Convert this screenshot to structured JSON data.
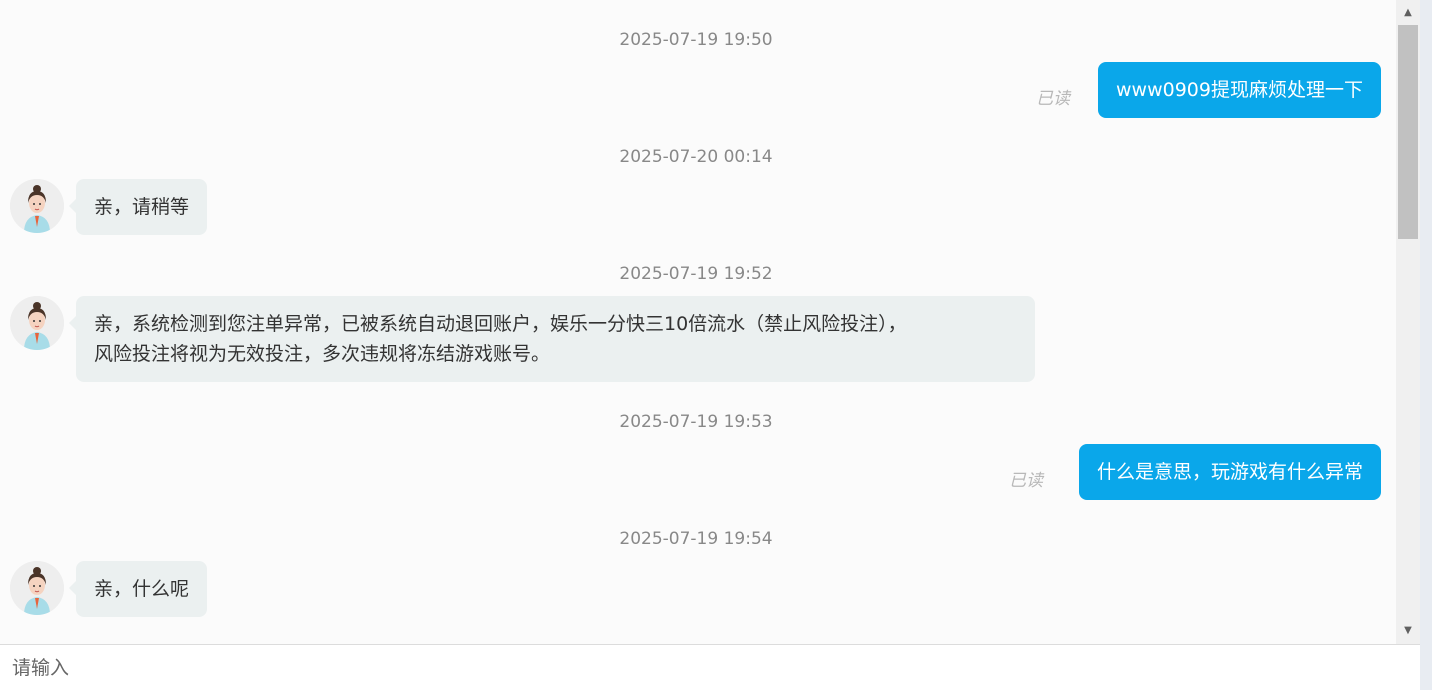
{
  "messages": [
    {
      "timestamp": "2025-07-19 19:50",
      "sender": "user",
      "text": "www0909提现麻烦处理一下",
      "status": "已读"
    },
    {
      "timestamp": "2025-07-20 00:14",
      "sender": "agent",
      "text": "亲，请稍等"
    },
    {
      "timestamp": "2025-07-19 19:52",
      "sender": "agent",
      "text_line1": "亲，系统检测到您注单异常，已被系统自动退回账户，娱乐一分快三10倍流水（禁止风险投注），",
      "text_line2": "风险投注将视为无效投注，多次违规将冻结游戏账号。"
    },
    {
      "timestamp": "2025-07-19 19:53",
      "sender": "user",
      "text": "什么是意思，玩游戏有什么异常",
      "status": "已读"
    },
    {
      "timestamp": "2025-07-19 19:54",
      "sender": "agent",
      "text": "亲，什么呢"
    }
  ],
  "input": {
    "placeholder": "请输入"
  },
  "scrollbar": {
    "up_arrow": "▲",
    "down_arrow": "▼"
  },
  "colors": {
    "user_bubble": "#0aa7ea",
    "agent_bubble": "#ebf0f0",
    "timestamp": "#888888",
    "read_status": "#b8b8b8"
  },
  "icons": {
    "agent_avatar": "agent-avatar-icon"
  }
}
